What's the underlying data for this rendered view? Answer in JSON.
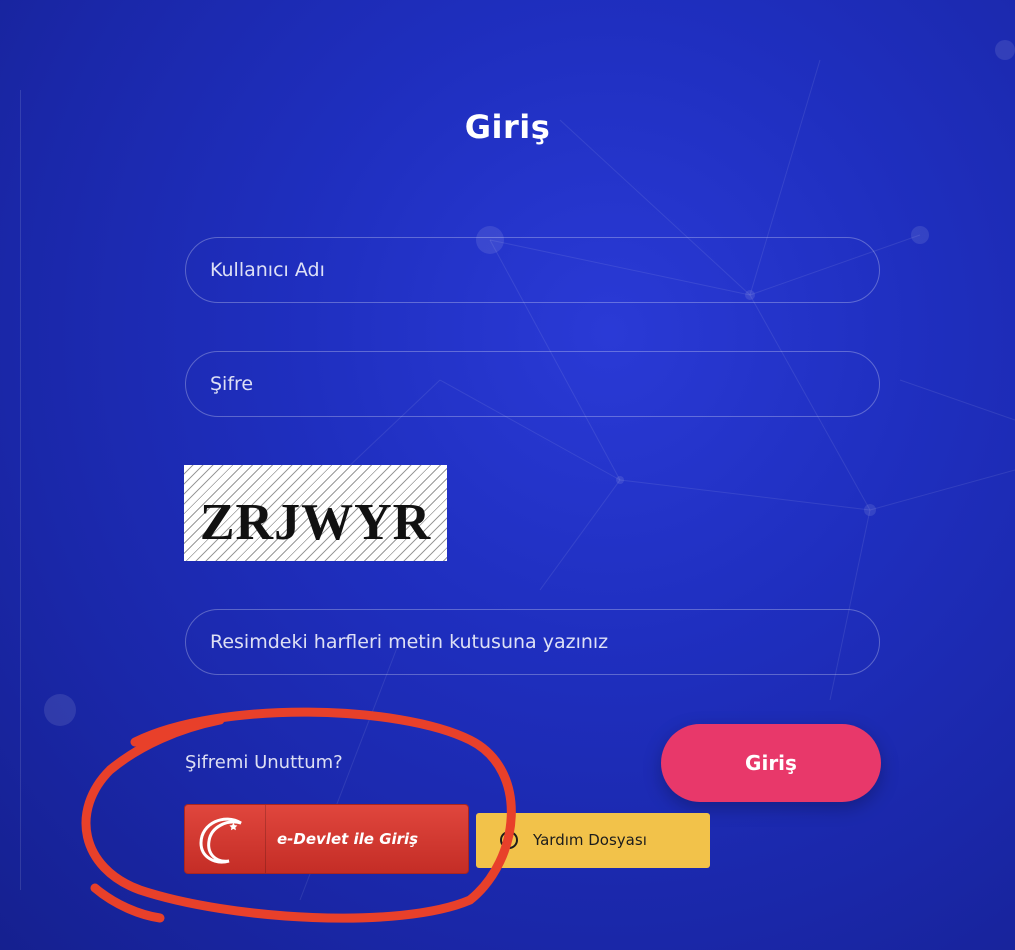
{
  "login": {
    "title": "Giriş",
    "username_placeholder": "Kullanıcı Adı",
    "password_placeholder": "Şifre",
    "captcha_text": "ZRJWYR",
    "captcha_placeholder": "Resimdeki harfleri metin kutusuna yazınız",
    "forgot_link": "Şifremi Unuttum?",
    "submit_label": "Giriş"
  },
  "alt_login": {
    "edevlet_label": "e-Devlet ile Giriş",
    "help_label": "Yardım Dosyası"
  },
  "colors": {
    "background": "#1f2fc0",
    "submit_button": "#e8386a",
    "edevlet_button": "#d23a32",
    "help_button": "#f2c24a",
    "annotation_stroke": "#e8402a"
  },
  "icons": {
    "edevlet_logo": "crescent-star-icon",
    "help": "help-circle-icon"
  }
}
